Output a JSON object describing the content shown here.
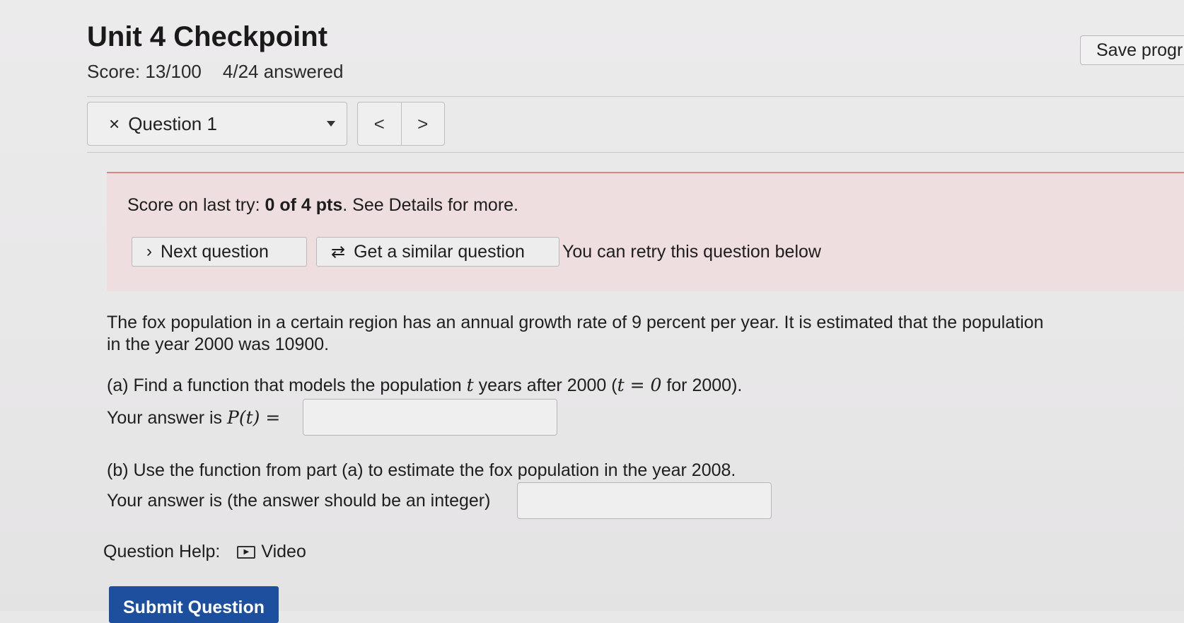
{
  "header": {
    "title": "Unit 4 Checkpoint",
    "score": "Score: 13/100",
    "answered": "4/24 answered",
    "save_label": "Save progr"
  },
  "question_nav": {
    "current_label": "Question 1",
    "status_icon": "×",
    "prev_symbol": "<",
    "next_symbol": ">"
  },
  "alert": {
    "prefix": "Score on last try: ",
    "points": "0 of 4 pts",
    "suffix": ". See Details for more.",
    "next_label": "Next question",
    "similar_label": "Get a similar question",
    "retry_text": "You can retry this question below"
  },
  "question": {
    "intro": "The fox population in a certain region has an annual growth rate of 9 percent per year. It is estimated that the population in the year 2000 was 10900.",
    "part_a": {
      "text_1": "(a) Find a function that models the population ",
      "var_t": "t",
      "text_2": " years after 2000 (",
      "eq": "t = 0",
      "text_3": " for 2000).",
      "answer_prefix": "Your answer is ",
      "answer_math": "P(t) =",
      "answer_value": ""
    },
    "part_b": {
      "text": "(b) Use the function from part (a) to estimate the fox population in the year 2008.",
      "answer_prefix": "Your answer is (the answer should be an integer)",
      "answer_value": ""
    }
  },
  "help": {
    "label": "Question Help:",
    "video_label": "Video"
  },
  "submit_label": "Submit Question",
  "colors": {
    "alert_bg": "#efdedf",
    "alert_border": "#d9857f",
    "submit_bg": "#1c4f9e"
  }
}
